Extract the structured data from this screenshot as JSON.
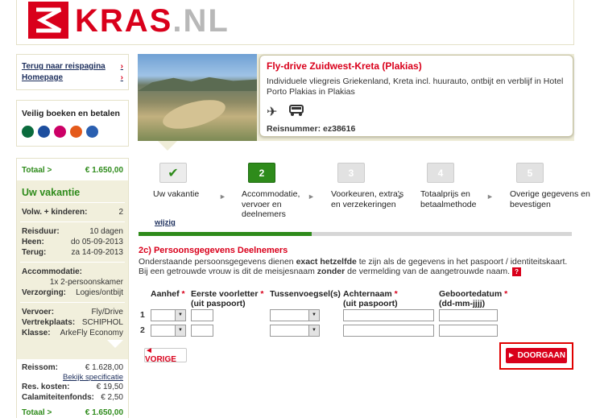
{
  "brand": {
    "logo_name": "KRAS",
    "logo_tld": ".NL",
    "accent": "#d9001b",
    "green": "#2e8b1b",
    "navy": "#1c2e5c"
  },
  "nav": {
    "back_label": "Terug naar reispagina",
    "home_label": "Homepage"
  },
  "secure": {
    "title": "Veilig boeken en betalen",
    "badges": [
      "sgr-icon",
      "iata-icon",
      "ideal-icon",
      "calamiteitenfonds-icon",
      "anvr-icon"
    ]
  },
  "summary": {
    "totaal_label": "Totaal >",
    "totaal_value": "€ 1.650,00",
    "heading": "Uw vakantie",
    "volw_label": "Volw. + kinderen:",
    "volw_value": "2",
    "reisduur_label": "Reisduur:",
    "reisduur_value": "10 dagen",
    "heen_label": "Heen:",
    "heen_value": "do 05-09-2013",
    "terug_label": "Terug:",
    "terug_value": "za 14-09-2013",
    "accommodatie_label": "Accommodatie:",
    "accommodatie_value": "1x 2-persoonskamer",
    "verzorging_label": "Verzorging:",
    "verzorging_value": "Logies/ontbijt",
    "vervoer_label": "Vervoer:",
    "vervoer_value": "Fly/Drive",
    "vertrekplaats_label": "Vertrekplaats:",
    "vertrekplaats_value": "SCHIPHOL",
    "klasse_label": "Klasse:",
    "klasse_value": "ArkeFly Economy",
    "reissom_label": "Reissom:",
    "reissom_value": "€ 1.628,00",
    "specificatie_link": "Bekijk specificatie",
    "reskosten_label": "Res. kosten:",
    "reskosten_value": "€ 19,50",
    "calamiteit_label": "Calamiteitenfonds:",
    "calamiteit_value": "€ 2,50",
    "totaal2_label": "Totaal >",
    "totaal2_value": "€ 1.650,00"
  },
  "trip": {
    "title": "Fly-drive Zuidwest-Kreta (Plakias)",
    "description": "Individuele vliegreis Griekenland, Kreta incl. huurauto, ontbijt en verblijf in Hotel Porto Plakias in Plakias",
    "icons": [
      "plane-icon",
      "car-icon"
    ],
    "reisnummer": "Reisnummer: ez38616"
  },
  "steps": {
    "s1": {
      "num": "✔",
      "label": "Uw vakantie"
    },
    "s2": {
      "num": "2",
      "label": "Accommodatie, vervoer en deelnemers"
    },
    "s3": {
      "num": "3",
      "label": "Voorkeuren, extra's en verzekeringen"
    },
    "s4": {
      "num": "4",
      "label": "Totaalprijs en betaalmethode"
    },
    "s5": {
      "num": "5",
      "label": "Overige gegevens en bevestigen"
    },
    "separator": "►",
    "wijzig": "wijzig",
    "progress": 0.4
  },
  "form": {
    "title": "2c) Persoonsgegevens Deelnemers",
    "intro_a": "Onderstaande persoonsgegevens dienen ",
    "intro_b": "exact hetzelfde",
    "intro_c": " te zijn als de gegevens in het paspoort / identiteitskaart. Bij een getrouwde vrouw is dit de meisjesnaam ",
    "intro_d": "zonder",
    "intro_e": " de vermelding van de aangetrouwde naam.",
    "help": "?",
    "req": "*",
    "col_aanhef": "Aanhef",
    "col_voorletter_1": "Eerste voorletter",
    "col_voorletter_2": "(uit paspoort)",
    "col_tussenvoegsel": "Tussenvoegsel(s)",
    "col_achternaam_1": "Achternaam",
    "col_achternaam_2": "(uit paspoort)",
    "col_geboorte_1": "Geboortedatum",
    "col_geboorte_2": "(dd-mm-jjjj)",
    "row1": "1",
    "row2": "2",
    "dropdown": "▼"
  },
  "buttons": {
    "vorige": "◄ VORIGE",
    "doorgaan": "► DOORGAAN"
  }
}
